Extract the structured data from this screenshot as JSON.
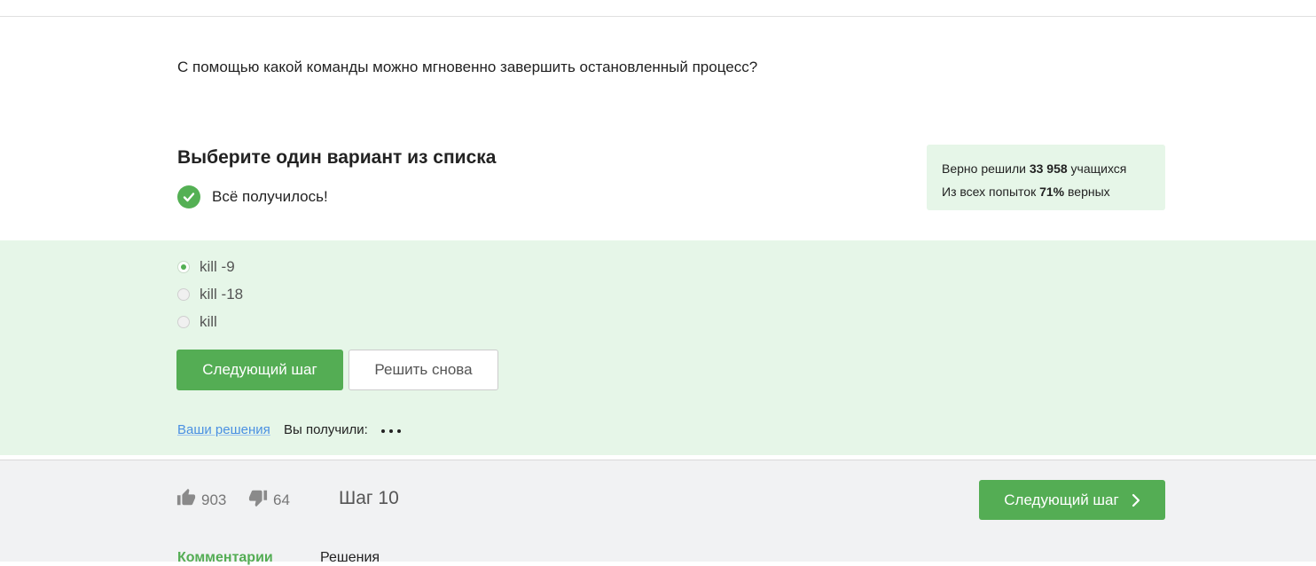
{
  "question": {
    "text": "С помощью какой команды можно мгновенно завершить остановленный процесс?"
  },
  "task": {
    "title": "Выберите один вариант из списка",
    "success_text": "Всё получилось!"
  },
  "stats": {
    "solved_prefix": "Верно решили",
    "solved_count": "33 958",
    "solved_suffix": "учащихся",
    "attempts_prefix": "Из всех попыток",
    "attempts_percent": "71%",
    "attempts_suffix": "верных"
  },
  "options": [
    {
      "label": "kill -9",
      "selected": true
    },
    {
      "label": "kill -18",
      "selected": false
    },
    {
      "label": "kill",
      "selected": false
    }
  ],
  "buttons": {
    "next_step": "Следующий шаг",
    "solve_again": "Решить снова"
  },
  "result": {
    "your_solutions": "Ваши решения",
    "you_got": "Вы получили:"
  },
  "footer": {
    "likes": "903",
    "dislikes": "64",
    "step": "Шаг 10",
    "next_step": "Следующий шаг",
    "tabs": {
      "comments": "Комментарии",
      "solutions": "Решения"
    }
  },
  "colors": {
    "accent_green": "#54ad54",
    "light_green_bg": "#e6f6e8",
    "link_blue": "#4a90e2"
  }
}
